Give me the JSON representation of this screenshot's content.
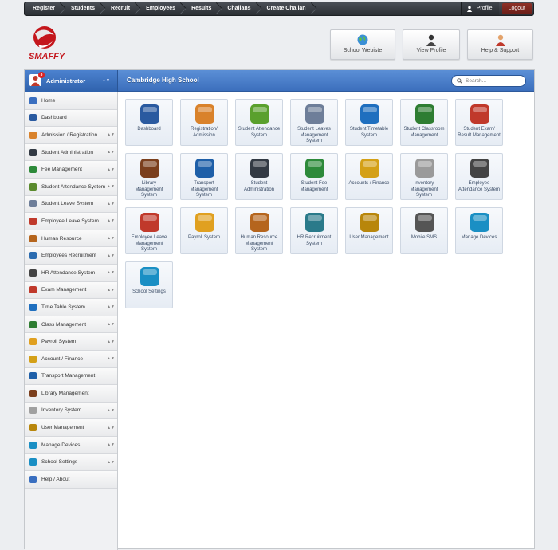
{
  "topnav": {
    "items": [
      "Register",
      "Students",
      "Recruit",
      "Employees",
      "Results",
      "Challans",
      "Create Challan"
    ],
    "profile_label": "Profile",
    "logout_label": "Logout"
  },
  "brand": {
    "logo_text": "SMAFFY",
    "accent": "#c4161c"
  },
  "header_buttons": [
    {
      "label": "School Webiste",
      "icon": "globe-icon"
    },
    {
      "label": "View Profile",
      "icon": "user-icon"
    },
    {
      "label": "Help & Support",
      "icon": "support-icon"
    }
  ],
  "panel": {
    "admin_name": "Administrator",
    "notification_count": "3",
    "school_name": "Cambridge High School",
    "search_placeholder": "Search..."
  },
  "sidebar": {
    "items": [
      {
        "label": "Home",
        "icon": "home-icon",
        "color": "#3a6fc0",
        "caret": false
      },
      {
        "label": "Dashboard",
        "icon": "dashboard-icon",
        "color": "#2a5aa0",
        "caret": false
      },
      {
        "label": "Admission / Registration",
        "icon": "admission-icon",
        "color": "#d9822b",
        "caret": true
      },
      {
        "label": "Student Administration",
        "icon": "student-admin-icon",
        "color": "#333a44",
        "caret": true
      },
      {
        "label": "Fee Management",
        "icon": "fee-icon",
        "color": "#2d8a3a",
        "caret": true
      },
      {
        "label": "Student Attendance System",
        "icon": "attendance-icon",
        "color": "#5a8a2d",
        "caret": true
      },
      {
        "label": "Student Leave System",
        "icon": "leave-icon",
        "color": "#6e7e99",
        "caret": true
      },
      {
        "label": "Employee Leave System",
        "icon": "calendar-icon",
        "color": "#c0392b",
        "caret": true
      },
      {
        "label": "Human Resource",
        "icon": "hr-icon",
        "color": "#b5651d",
        "caret": true
      },
      {
        "label": "Employees Recruitment",
        "icon": "recruitment-icon",
        "color": "#2b6cb0",
        "caret": true
      },
      {
        "label": "HR Attendance System",
        "icon": "hr-attendance-icon",
        "color": "#444",
        "caret": true
      },
      {
        "label": "Exam Management",
        "icon": "exam-icon",
        "color": "#c0392b",
        "caret": true
      },
      {
        "label": "Time Table System",
        "icon": "timetable-icon",
        "color": "#1f6fbf",
        "caret": true
      },
      {
        "label": "Class Management",
        "icon": "class-icon",
        "color": "#2e7d32",
        "caret": true
      },
      {
        "label": "Payroll System",
        "icon": "payroll-icon",
        "color": "#e0a020",
        "caret": true
      },
      {
        "label": "Account / Finance",
        "icon": "finance-icon",
        "color": "#d4a017",
        "caret": true
      },
      {
        "label": "Transport Management",
        "icon": "bus-icon",
        "color": "#1e5fa8",
        "caret": false
      },
      {
        "label": "Library Management",
        "icon": "library-icon",
        "color": "#7b3f1d",
        "caret": false
      },
      {
        "label": "Inventory System",
        "icon": "inventory-icon",
        "color": "#a0a0a0",
        "caret": true
      },
      {
        "label": "User Management",
        "icon": "user-management-icon",
        "color": "#b8860b",
        "caret": true
      },
      {
        "label": "Manage Devices",
        "icon": "devices-icon",
        "color": "#1a8fc4",
        "caret": true
      },
      {
        "label": "School Settings",
        "icon": "settings-icon",
        "color": "#1a8fc4",
        "caret": true
      },
      {
        "label": "Help / About",
        "icon": "help-icon",
        "color": "#3a6fc0",
        "caret": false
      }
    ]
  },
  "tiles": [
    {
      "label": "Dashboard",
      "icon": "dashboard-icon",
      "color": "#2a5aa0"
    },
    {
      "label": "Registration/ Admission",
      "icon": "admission-icon",
      "color": "#d9822b"
    },
    {
      "label": "Student Attendance System",
      "icon": "attendance-icon",
      "color": "#5aa02d"
    },
    {
      "label": "Student Leaves Management System",
      "icon": "leave-icon",
      "color": "#6e7e99"
    },
    {
      "label": "Student Timetable System",
      "icon": "timetable-icon",
      "color": "#1f6fbf"
    },
    {
      "label": "Student Classroom Management",
      "icon": "classroom-icon",
      "color": "#2e7d32"
    },
    {
      "label": "Student Exam/ Result Management",
      "icon": "exam-icon",
      "color": "#c0392b"
    },
    {
      "label": "Library Management System",
      "icon": "library-icon",
      "color": "#7b3f1d"
    },
    {
      "label": "Transport Management System",
      "icon": "bus-icon",
      "color": "#1e5fa8"
    },
    {
      "label": "Student Administration",
      "icon": "student-admin-icon",
      "color": "#333a44"
    },
    {
      "label": "Student Fee Management",
      "icon": "fee-icon",
      "color": "#2d8a3a"
    },
    {
      "label": "Accounts / Finance",
      "icon": "finance-icon",
      "color": "#d4a017"
    },
    {
      "label": "Inventory Management System",
      "icon": "inventory-icon",
      "color": "#9a9a9a"
    },
    {
      "label": "Employee Attendance System",
      "icon": "hr-attendance-icon",
      "color": "#444"
    },
    {
      "label": "Employee Leave Management System",
      "icon": "calendar-icon",
      "color": "#c0392b"
    },
    {
      "label": "Payroll System",
      "icon": "payroll-icon",
      "color": "#e0a020"
    },
    {
      "label": "Human Resource Management System",
      "icon": "hr-icon",
      "color": "#b5651d"
    },
    {
      "label": "HR Recruitment System",
      "icon": "recruitment-icon",
      "color": "#2a7a8a"
    },
    {
      "label": "User Management",
      "icon": "user-management-icon",
      "color": "#b8860b"
    },
    {
      "label": "Mobile SMS",
      "icon": "sms-icon",
      "color": "#555"
    },
    {
      "label": "Manage Devices",
      "icon": "devices-icon",
      "color": "#1a8fc4"
    },
    {
      "label": "School Settings",
      "icon": "settings-icon",
      "color": "#1a8fc4"
    }
  ]
}
